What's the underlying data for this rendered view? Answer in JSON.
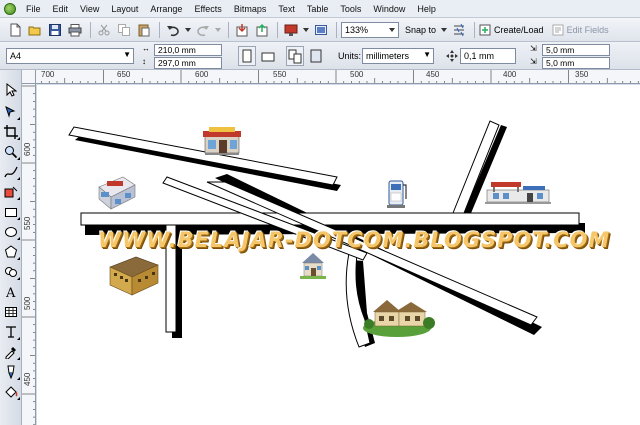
{
  "menu": {
    "items": [
      "File",
      "Edit",
      "View",
      "Layout",
      "Arrange",
      "Effects",
      "Bitmaps",
      "Text",
      "Table",
      "Tools",
      "Window",
      "Help"
    ]
  },
  "toolbar": {
    "zoom": "133%",
    "snap_to": "Snap to",
    "create_load": "Create/Load",
    "edit_fields": "Edit Fields"
  },
  "property_bar": {
    "page_size": "A4",
    "width": "210,0 mm",
    "height": "297,0 mm",
    "units_label": "Units:",
    "units": "millimeters",
    "nudge": "0,1 mm",
    "dup_x": "5,0 mm",
    "dup_y": "5,0 mm"
  },
  "ruler_h": [
    "700",
    "650",
    "600",
    "550",
    "500",
    "450",
    "400",
    "350"
  ],
  "ruler_v": [
    "600",
    "550",
    "500",
    "450"
  ],
  "watermark": "WWW.BELAJAR-DOTCOM.BLOGSPOT.COM",
  "colors": {
    "app_bg": "#d4dbe8",
    "watermark_fill": "#f6c76a",
    "watermark_shadow": "#7b4f0a"
  },
  "icons": {
    "tools": [
      "pick-tool-icon",
      "shape-tool-icon",
      "crop-tool-icon",
      "zoom-tool-icon",
      "freehand-tool-icon",
      "smart-fill-icon",
      "rectangle-tool-icon",
      "ellipse-tool-icon",
      "polygon-tool-icon",
      "basic-shapes-icon",
      "text-tool-icon",
      "table-tool-icon",
      "dimension-tool-icon",
      "eyedropper-icon",
      "outline-pen-icon",
      "fill-tool-icon"
    ]
  }
}
